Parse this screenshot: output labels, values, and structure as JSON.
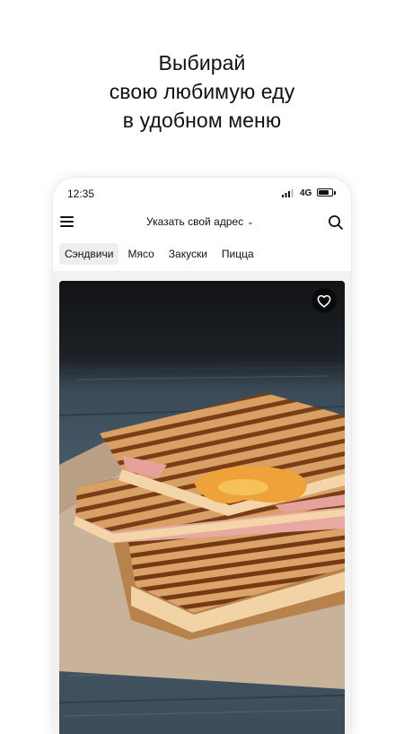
{
  "promo": {
    "line1": "Выбирай",
    "line2": "свою любимую еду",
    "line3": "в удобном меню"
  },
  "status_bar": {
    "time": "12:35",
    "network": "4G",
    "battery_level": 0.8
  },
  "header": {
    "address_label": "Указать свой адрес",
    "menu_icon": "hamburger-menu-icon",
    "search_icon": "search-icon",
    "address_icon": "chevron-down-icon"
  },
  "categories": [
    {
      "label": "Сэндвичи",
      "active": true
    },
    {
      "label": "Мясо",
      "active": false
    },
    {
      "label": "Закуски",
      "active": false
    },
    {
      "label": "Пицца",
      "active": false
    }
  ],
  "product_card": {
    "image": "grilled-ham-cheese-sandwich-photo",
    "favorite_icon": "heart-outline-icon"
  },
  "colors": {
    "background": "#ffffff",
    "text": "#111111",
    "active_tab": "#eeeeee"
  }
}
